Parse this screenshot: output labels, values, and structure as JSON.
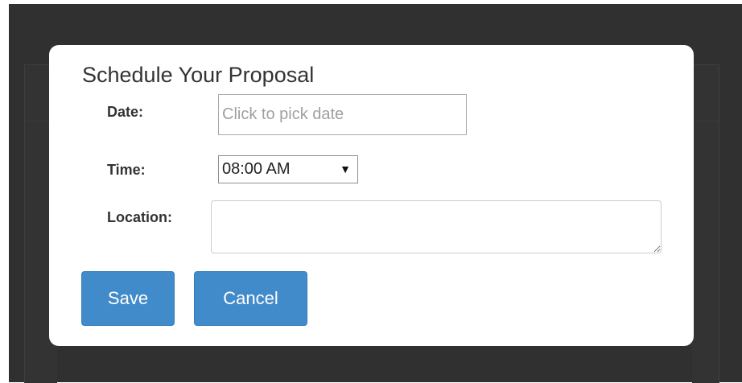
{
  "modal": {
    "title": "Schedule Your Proposal",
    "date": {
      "label": "Date:",
      "placeholder": "Click to pick date",
      "value": ""
    },
    "time": {
      "label": "Time:",
      "selected": "08:00 AM",
      "arrow_icon": "dropdown-triangle-icon"
    },
    "location": {
      "label": "Location:",
      "value": ""
    },
    "buttons": {
      "save_label": "Save",
      "cancel_label": "Cancel"
    }
  },
  "colors": {
    "backdrop": "#303030",
    "modal_background": "#ffffff",
    "primary_button": "#428bca",
    "text": "#333333"
  }
}
